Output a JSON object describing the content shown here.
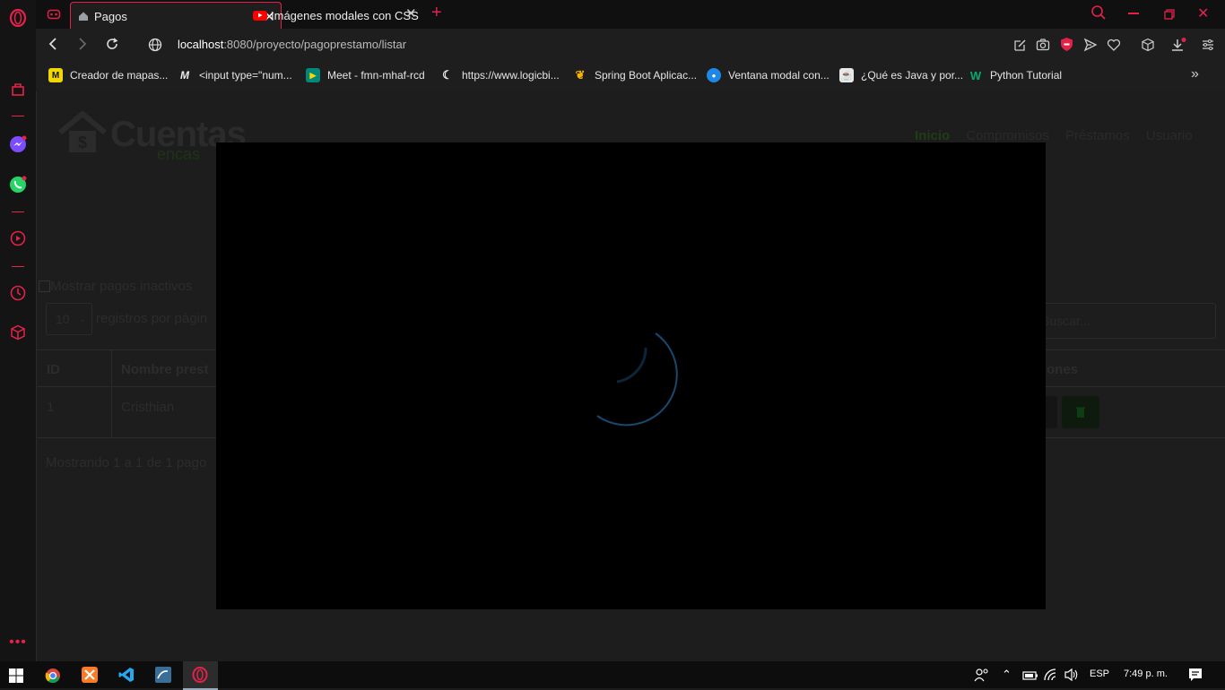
{
  "browser": {
    "tabs": [
      {
        "title": "Pagos"
      },
      {
        "title": "Imágenes modales con CSS"
      }
    ],
    "url_host": "localhost",
    "url_rest": ":8080/proyecto/pagoprestamo/listar"
  },
  "bookmarks": [
    {
      "label": "Creador de mapas...",
      "icon": "miro-icon",
      "color": "#f2d600",
      "glyph": "M"
    },
    {
      "label": "<input type=\"num...",
      "icon": "m-letter-icon",
      "color": "#1e1e1e",
      "glyph": "M"
    },
    {
      "label": "Meet - fmn-mhaf-rcd",
      "icon": "meet-icon",
      "color": "#00897b",
      "glyph": "▶"
    },
    {
      "label": "https://www.logicbi...",
      "icon": "moon-icon",
      "color": "#1e1e1e",
      "glyph": "☾"
    },
    {
      "label": "Spring Boot Aplicac...",
      "icon": "spring-icon",
      "color": "#1e1e1e",
      "glyph": "❦"
    },
    {
      "label": "Ventana modal con...",
      "icon": "circle-icon",
      "color": "#1e88e5",
      "glyph": "●"
    },
    {
      "label": "¿Qué es Java y por...",
      "icon": "java-icon",
      "color": "#e8e8e8",
      "glyph": "☕"
    },
    {
      "label": "Python Tutorial",
      "icon": "w3-icon",
      "color": "#1e1e1e",
      "glyph": "W"
    }
  ],
  "site": {
    "logo_text": "Cuentas",
    "logo_sub": "encas",
    "nav": [
      "Inicio",
      "Compromisos",
      "Préstamos",
      "Usuario"
    ],
    "checkbox_label": "Mostrar pagos inactivos",
    "page_size": "10",
    "page_size_label": "registros por págin",
    "search_placeholder": "Buscar...",
    "table": {
      "headers": [
        "ID",
        "Nombre prest",
        "ones"
      ],
      "rows": [
        {
          "id": "1",
          "name": "Cristhian"
        }
      ]
    },
    "footer_info": "Mostrando 1 a 1 de 1 pago"
  },
  "taskbar": {
    "lang": "ESP",
    "time": "7:49 p. m."
  },
  "colors": {
    "accent": "#e3224a",
    "modal_bg": "#000000",
    "loader": "#1e5a8a"
  }
}
